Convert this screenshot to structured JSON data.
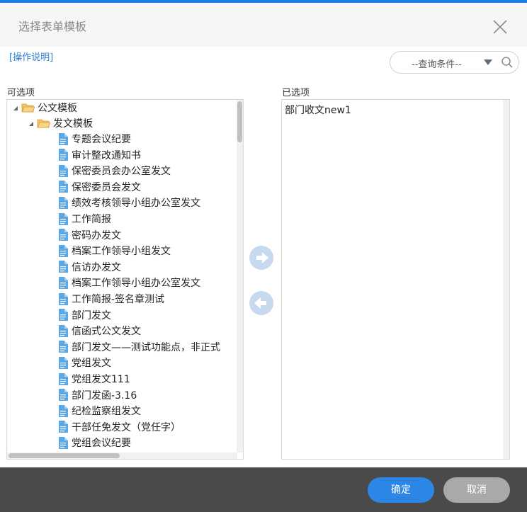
{
  "dialog": {
    "title": "选择表单模板",
    "help_link": "[操作说明]"
  },
  "query": {
    "label": "--查询条件--"
  },
  "available": {
    "label": "可选项",
    "root": "公文模板",
    "folder": "发文模板",
    "items": [
      "专题会议纪要",
      "审计整改通知书",
      "保密委员会办公室发文",
      "保密委员会发文",
      "绩效考核领导小组办公室发文",
      "工作简报",
      "密码办发文",
      "档案工作领导小组发文",
      "信访办发文",
      "档案工作领导小组办公室发文",
      "工作简报-签名章测试",
      "部门发文",
      "信函式公文发文",
      "部门发文——测试功能点，非正式",
      "党组发文",
      "党组发文111",
      "部门发函-3.16",
      "纪检监察组发文",
      "干部任免发文（党任字）",
      "党组会议纪要"
    ]
  },
  "selected": {
    "label": "已选项",
    "items": [
      "部门收文new1"
    ]
  },
  "footer": {
    "ok_label": "确定",
    "cancel_label": "取消"
  },
  "colors": {
    "accent": "#1a7ee8",
    "ok_button": "#2b86e6",
    "cancel_button": "#a9a9a9",
    "footer_bg": "#4a4a4a",
    "doc_icon": "#5aa9e6",
    "folder_icon": "#f0b64a",
    "link": "#2a7fd4"
  },
  "icons": {
    "close": "close-icon",
    "search": "search-icon",
    "dropdown": "caret-down-icon",
    "folder": "folder-open-icon",
    "document": "document-icon",
    "move_right": "arrow-right-circle-icon",
    "move_left": "arrow-left-circle-icon"
  }
}
